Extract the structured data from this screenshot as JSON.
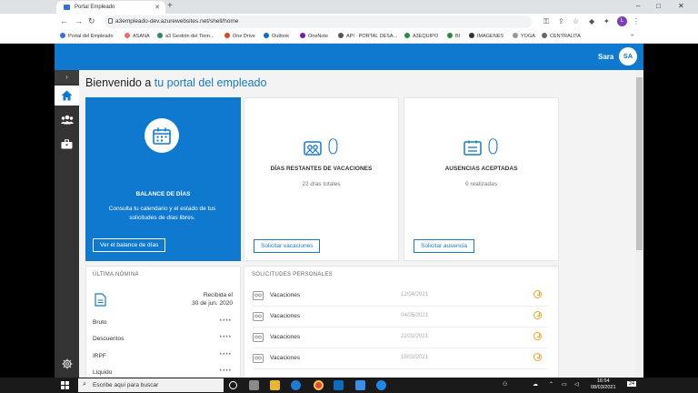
{
  "browser": {
    "tab_title": "Portal Empleado",
    "url": "a3empleado-dev.azurewebsites.net/shell/home",
    "profile_initial": "L",
    "bookmarks": [
      {
        "label": "Portal del Empleado",
        "color": "#3a6fd8"
      },
      {
        "label": "ASANA",
        "color": "#f06a6a"
      },
      {
        "label": "a3 Gestión del Tiem...",
        "color": "#2e8b57"
      },
      {
        "label": "One Drive",
        "color": "#d04a2a"
      },
      {
        "label": "Outlook",
        "color": "#0f6cbd"
      },
      {
        "label": "OneNote",
        "color": "#7719aa"
      },
      {
        "label": "API · PORTAL DESA...",
        "color": "#555555"
      },
      {
        "label": "A3EQUIPO",
        "color": "#2b8a3e"
      },
      {
        "label": "BI",
        "color": "#2b8a3e"
      },
      {
        "label": "IMAGENES",
        "color": "#333333"
      },
      {
        "label": "YOGA",
        "color": "#999999"
      },
      {
        "label": "CENTRALITA",
        "color": "#666666"
      }
    ],
    "more": "»"
  },
  "header": {
    "user_name": "Sara",
    "avatar_initials": "SA",
    "accent": "#0f79d0"
  },
  "sidenav": {
    "toggle": "›",
    "items": [
      {
        "icon": "home-icon",
        "active": true
      },
      {
        "icon": "people-icon",
        "active": false
      },
      {
        "icon": "briefcase-icon",
        "active": false
      }
    ],
    "settings_icon": "gear-icon"
  },
  "main": {
    "title_prefix": "Bienvenido a ",
    "title_accent": "tu portal del empleado",
    "cards": {
      "balance": {
        "title": "BALANCE DE DÍAS",
        "description": "Consulta tu calendario y el estado de tus solicitudes de días libres.",
        "button": "Ver el balance de días"
      },
      "vacaciones": {
        "count": "0",
        "title": "DÍAS RESTANTES DE VACACIONES",
        "subtitle": "22 días totales",
        "button": "Solicitar vacaciones"
      },
      "ausencias": {
        "count": "0",
        "title": "AUSENCIAS ACEPTADAS",
        "subtitle": "0 realizadas",
        "button": "Solicitar ausencia"
      }
    },
    "nomina": {
      "header": "ÚLTIMA NÓMINA",
      "received_label": "Recibida el",
      "received_date": "30 de jun. 2020",
      "rows": [
        {
          "label": "Bruto",
          "value": "****"
        },
        {
          "label": "Descuentos",
          "value": "****"
        },
        {
          "label": "IRPF",
          "value": "****"
        },
        {
          "label": "Líquido",
          "value": "****"
        }
      ]
    },
    "solicitudes": {
      "header": "SOLICITUDES PERSONALES",
      "items": [
        {
          "type": "Vacaciones",
          "date": "12/04/2021"
        },
        {
          "type": "Vacaciones",
          "date": "04/05/2021"
        },
        {
          "type": "Vacaciones",
          "date": "22/02/2021"
        },
        {
          "type": "Vacaciones",
          "date": "15/02/2021"
        }
      ]
    }
  },
  "taskbar": {
    "search_placeholder": "Escribe aquí para buscar",
    "time": "16:54",
    "date": "08/03/2021",
    "notification_count": "24"
  }
}
